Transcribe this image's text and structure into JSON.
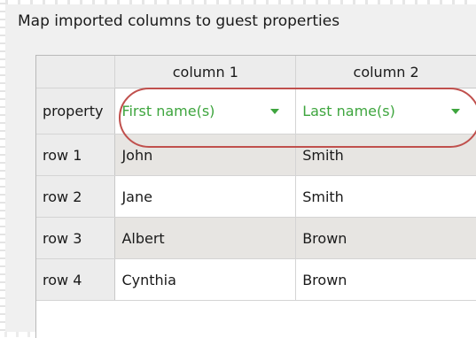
{
  "group": {
    "title": "Map imported columns to guest properties"
  },
  "table": {
    "columns": [
      "column 1",
      "column 2"
    ],
    "property_row": {
      "label": "property",
      "selections": [
        "First name(s)",
        "Last name(s)"
      ]
    },
    "rows": [
      {
        "label": "row 1",
        "cells": [
          "John",
          "Smith"
        ]
      },
      {
        "label": "row 2",
        "cells": [
          "Jane",
          "Smith"
        ]
      },
      {
        "label": "row 3",
        "cells": [
          "Albert",
          "Brown"
        ]
      },
      {
        "label": "row 4",
        "cells": [
          "Cynthia",
          "Brown"
        ]
      }
    ]
  },
  "colors": {
    "dropdown_text": "#3ea53e",
    "highlight": "#c0504d"
  }
}
